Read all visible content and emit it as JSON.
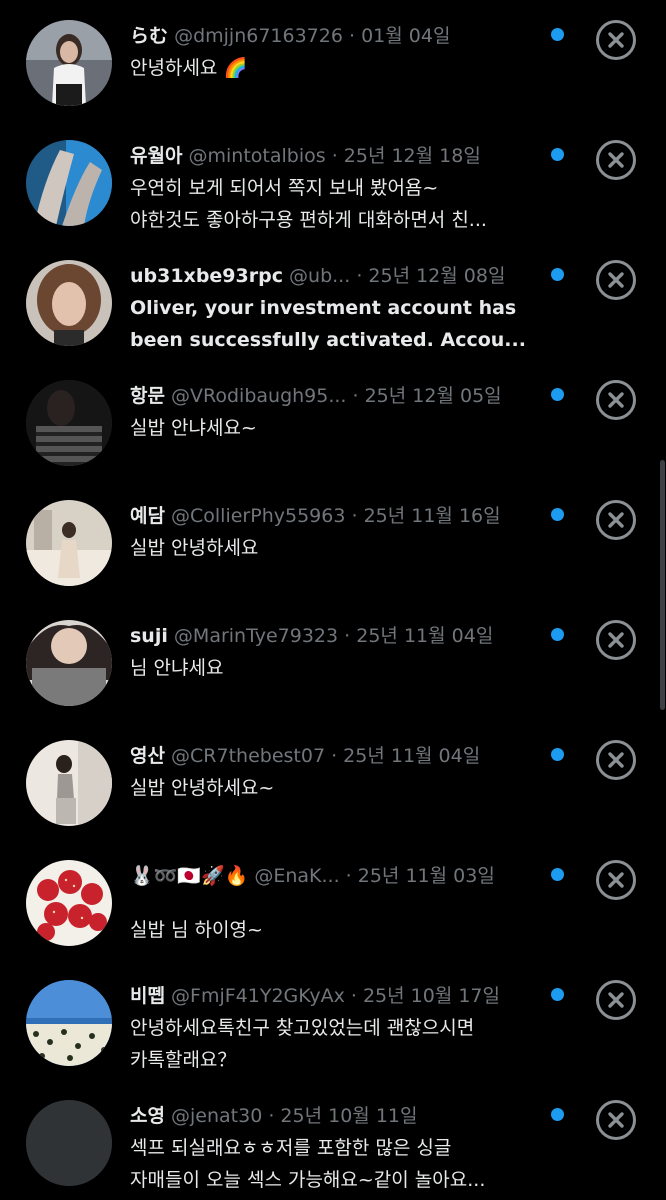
{
  "conversations": [
    {
      "name": "らむ",
      "handle": "@dmjjn67163726",
      "date": "· 01월 04일",
      "message": "안녕하세요 🌈",
      "unread": true,
      "avatar": "photo-woman-white-top"
    },
    {
      "name": "유월아",
      "handle": "@mintotalbios",
      "date": "· 25년 12월 18일",
      "message": "우연히 보게 되어서 쪽지 보내 봤어욤~",
      "message2": "야한것도 좋아하구용 편하게 대화하면서 친...",
      "unread": true,
      "avatar": "photo-legs"
    },
    {
      "name": "ub31xbe93rpc",
      "handle": "@ub...",
      "date": "· 25년 12월 08일",
      "message": "Oliver, your investment account has",
      "message2": "been successfully activated. Accou...",
      "unread": true,
      "avatar": "photo-woman-brown-hair"
    },
    {
      "name": "항문",
      "handle": "@VRodibaugh95...",
      "date": "· 25년 12월 05일",
      "message": "실밥 안냐세요~",
      "unread": true,
      "avatar": "photo-woman-striped-top"
    },
    {
      "name": "예담",
      "handle": "@CollierPhy55963",
      "date": "· 25년 11월 16일",
      "message": "실밥 안녕하세요",
      "unread": true,
      "avatar": "photo-woman-room"
    },
    {
      "name": "suji",
      "handle": "@MarinTye79323",
      "date": "· 25년 11월 04일",
      "message": "님 안냐세요",
      "unread": true,
      "avatar": "photo-woman-grey-top"
    },
    {
      "name": "영산",
      "handle": "@CR7thebest07",
      "date": "· 25년 11월 04일",
      "message": "실밥 안녕하세요~",
      "unread": true,
      "avatar": "photo-woman-mirror"
    },
    {
      "name": "🐰➿🇯🇵🚀🔥",
      "handle": "@EnaK...",
      "date": "· 25년 11월 03일",
      "message": "실밥 님 하이영~",
      "unread": true,
      "avatar": "photo-strawberries"
    },
    {
      "name": "비뗍",
      "handle": "@FmjF41Y2GKyAx",
      "date": "· 25년 10월 17일",
      "message": "안녕하세요톡친구 찾고있었는데  괜찮으시면",
      "message2": "카톡할래요？",
      "unread": true,
      "avatar": "photo-floral-skirt"
    },
    {
      "name": "소영",
      "handle": "@jenat30",
      "date": "· 25년 10월 11일",
      "message": "섹프 되실래요ㅎㅎ저를 포함한 많은 싱글",
      "message2": "자매들이 오늘 섹스 가능해요~같이 놀아요...",
      "unread": true,
      "avatar": "default-avatar-grey"
    }
  ],
  "colors": {
    "background": "#000000",
    "text_primary": "#e7e9ea",
    "text_secondary": "#71767b",
    "unread_dot": "#1d9bf0",
    "close_icon": "#8b9095"
  },
  "icons": {
    "unread": "blue-dot-icon",
    "dismiss": "close-circle-icon"
  }
}
